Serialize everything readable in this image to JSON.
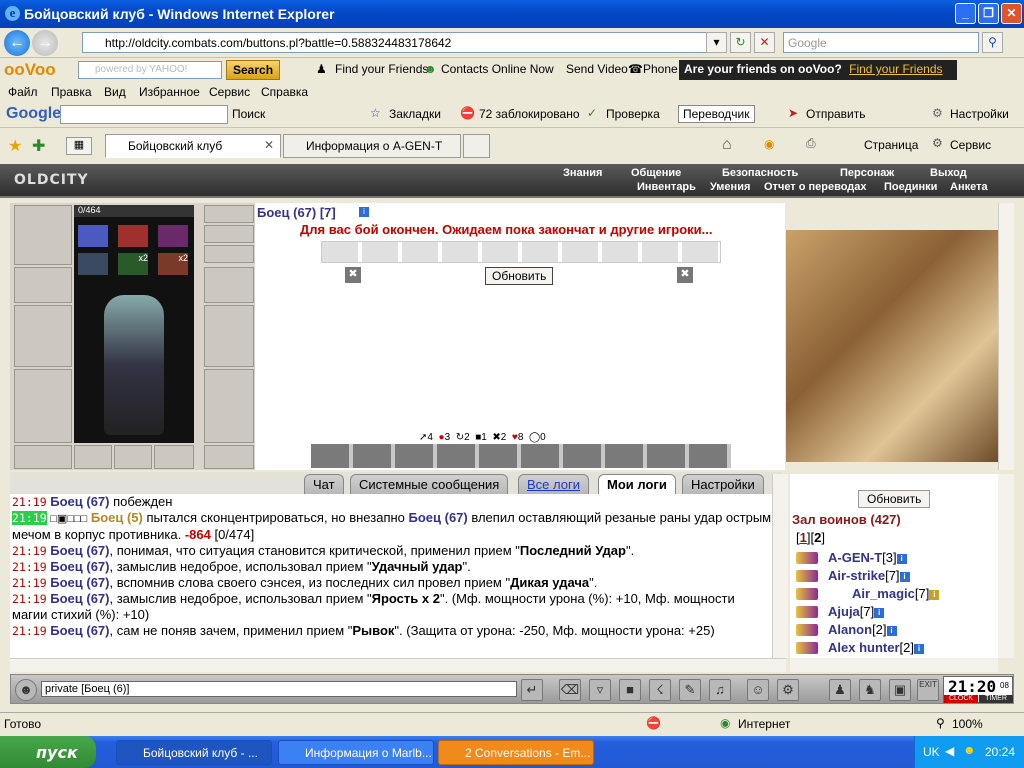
{
  "window": {
    "title": "Бойцовский клуб - Windows Internet Explorer",
    "min": "_",
    "max": "❐",
    "close": "✕"
  },
  "address": {
    "url": "http://oldcity.combats.com/buttons.pl?battle=0.588324483178642",
    "search_placeholder": "Google"
  },
  "oovoo": {
    "logo": "ooVoo",
    "search_text": "powered by YAHOO!",
    "search_button": "Search",
    "find_friends": "Find your Friends",
    "contacts": "Contacts Online Now",
    "send_video": "Send Video",
    "phone": "Phone",
    "promo": "Are your friends on ooVoo?",
    "promo_link": "Find your Friends"
  },
  "menu": [
    "Файл",
    "Правка",
    "Вид",
    "Избранное",
    "Сервис",
    "Справка"
  ],
  "google_bar": {
    "logo": "Google",
    "search_label": "Поиск",
    "bookmarks": "Закладки",
    "blocked": "72 заблокировано",
    "check": "Проверка",
    "translate": "Переводчик",
    "send": "Отправить",
    "settings": "Настройки"
  },
  "tabs": [
    {
      "label": "Бойцовский клуб",
      "active": true
    },
    {
      "label": "Информация о A-GEN-T",
      "active": false
    }
  ],
  "ie_cmd": {
    "page": "Страница",
    "tools": "Сервис"
  },
  "game": {
    "logo": "OLDCITY",
    "top_menu": [
      "Знания",
      "Общение",
      "Безопасность",
      "Персонаж",
      "Выход"
    ],
    "sub_menu": [
      "Инвентарь",
      "Умения",
      "Отчет о переводах",
      "Поединки",
      "Анкета"
    ],
    "hp": "0/464",
    "item_counts": [
      "x2",
      "x2"
    ],
    "fighter": "Боец (67) [7]",
    "battle_msg": "Для вас бой окончен. Ожидаем пока закончат и другие игроки...",
    "refresh_button": "Обновить",
    "stats": [
      "4",
      "3",
      "2",
      "1",
      "2",
      "8",
      "0"
    ]
  },
  "chat": {
    "tabs": [
      "Чат",
      "Системные сообщения",
      "Все логи",
      "Мои логи",
      "Настройки"
    ],
    "active_tab": "Мои логи",
    "log": [
      {
        "time": "21:19",
        "name": "Боец (67)",
        "text": " побежден"
      },
      {
        "time": "21:19",
        "name": "Боец (5)",
        "text": " пытался сконцентрироваться, но внезапно ",
        "name2": "Боец (67)",
        "text2": " влепил оставляющий резаные раны удар острым мечом в корпус противника. ",
        "damage": "-864",
        "tail": " [0/474]"
      },
      {
        "time": "21:19",
        "name": "Боец (67)",
        "text": ", понимая, что ситуация становится критической, применил прием \"",
        "bold": "Последний Удар",
        "tail": "\"."
      },
      {
        "time": "21:19",
        "name": "Боец (67)",
        "text": ", замыслив недоброе, использовал прием \"",
        "bold": "Удачный удар",
        "tail": "\"."
      },
      {
        "time": "21:19",
        "name": "Боец (67)",
        "text": ", вспомнив слова своего сэнсея, из последних сил провел прием \"",
        "bold": "Дикая удача",
        "tail": "\"."
      },
      {
        "time": "21:19",
        "name": "Боец (67)",
        "text": ", замыслив недоброе, использовал прием \"",
        "bold": "Ярость x 2",
        "tail": "\". (Мф. мощности урона (%): +10, Мф. мощности магии стихий (%): +10)"
      },
      {
        "time": "21:19",
        "name": "Боец (67)",
        "text": ", сам не поняв зачем, применил прием \"",
        "bold": "Рывок",
        "tail": "\". (Защита от урона: -250, Мф. мощности урона: +25)"
      }
    ],
    "input_value": "private [Боец (6)]"
  },
  "warriors": {
    "refresh_button": "Обновить",
    "title": "Зал воинов (427)",
    "pages": [
      "1",
      "2"
    ],
    "list": [
      {
        "name": "A-GEN-T",
        "level": "[3]"
      },
      {
        "name": "Air-strike",
        "level": "[7]"
      },
      {
        "name": "Air_magic",
        "level": "[7]"
      },
      {
        "name": "Ajuja",
        "level": "[7]"
      },
      {
        "name": "Alanon",
        "level": "[2]"
      },
      {
        "name": "Alex hunter",
        "level": "[2]"
      }
    ]
  },
  "clock": {
    "time": "21:20",
    "sec": "08",
    "clock_label": "CLOCK",
    "timer_label": "TIMER",
    "exit": "EXIT"
  },
  "status": {
    "left": "Готово",
    "zone": "Интернет",
    "zoom": "100%"
  },
  "taskbar": {
    "start": "пуск",
    "tasks": [
      "Бойцовский клуб - ...",
      "Информация о Marlb...",
      "2 Conversations - Em..."
    ],
    "lang": "UK",
    "time": "20:24"
  }
}
